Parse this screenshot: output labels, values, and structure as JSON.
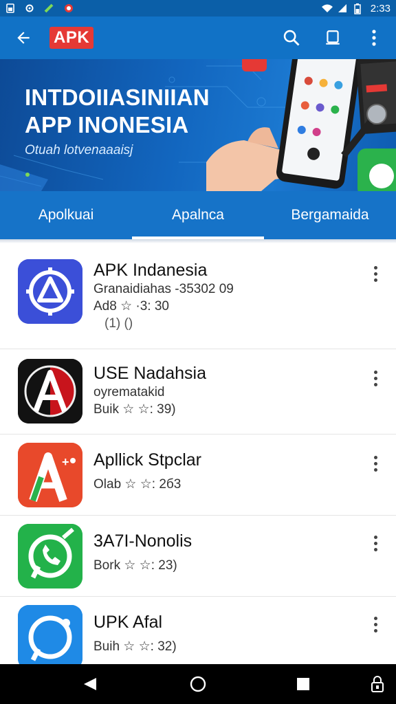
{
  "status_bar": {
    "time": "2:33",
    "left_icons": [
      "sim-icon",
      "settings-icon",
      "battery-saver-icon",
      "notification-icon"
    ],
    "right_icons": [
      "wifi-icon",
      "signal-icon",
      "battery-icon"
    ]
  },
  "app_bar": {
    "logo_text": "APK",
    "back_icon": "arrow-left-icon",
    "actions": [
      "search-icon",
      "share-icon",
      "more-vert-icon"
    ]
  },
  "banner": {
    "title_line1": "INTDOIIASINIIAN",
    "title_line2": "APP INONESIA",
    "subtitle": "Otuah lotvenaaaisj"
  },
  "tabs": [
    {
      "label": "Apolkuai",
      "active": false
    },
    {
      "label": "Apalnca",
      "active": true
    },
    {
      "label": "Bergamaida",
      "active": false
    }
  ],
  "apps": [
    {
      "name": "APK Indanesia",
      "line1": "Granaidiahas -35302 09",
      "line2": "Ad8 ☆ ·3: 30",
      "line3": "(1)  ()",
      "icon": "apk-triangle-icon",
      "icon_bg": "#3f51d6"
    },
    {
      "name": "USE Nadahsia",
      "line1": "oyrematakid",
      "line2": "Buik ☆ ☆: 39)",
      "line3": "",
      "icon": "letter-a-icon",
      "icon_bg": "#111111"
    },
    {
      "name": "Apllick Stpclar",
      "line1": "",
      "line2": "Olab ☆ ☆: 2б3",
      "line3": "",
      "icon": "letter-a-store-icon",
      "icon_bg": "#e8532a"
    },
    {
      "name": "3A7I-Nonolis",
      "line1": "",
      "line2": "Bork ☆ ☆: 23)",
      "line3": "",
      "icon": "phone-chat-icon",
      "icon_bg": "#28b84a"
    },
    {
      "name": "UPK Afal",
      "line1": "",
      "line2": "Buih ☆ ☆: 32)",
      "line3": "",
      "icon": "chat-bubble-icon",
      "icon_bg": "#1e88e5"
    }
  ],
  "nav_bar": [
    "back-triangle-icon",
    "home-circle-icon",
    "recents-square-icon",
    "lock-icon"
  ]
}
